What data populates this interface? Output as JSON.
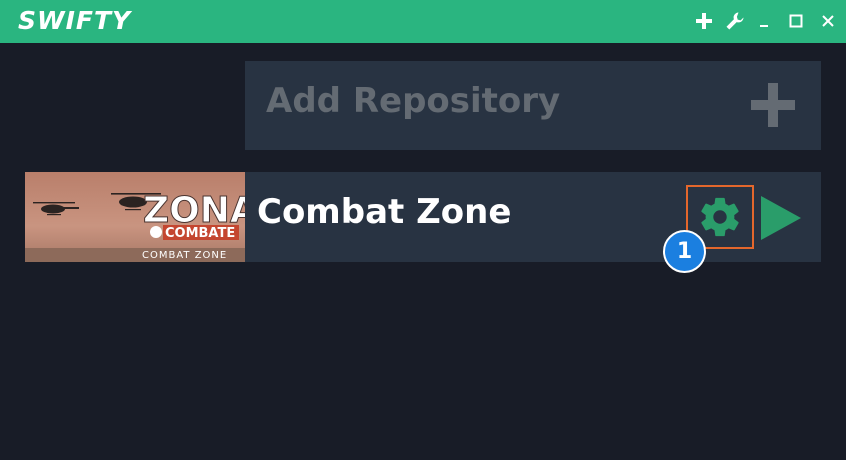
{
  "app": {
    "title": "SWIFTY"
  },
  "window_controls": {
    "add": "+",
    "settings_icon": "wrench-icon",
    "minimize": "_",
    "maximize": "☐",
    "close": "✕"
  },
  "add_repository": {
    "label": "Add Repository",
    "icon": "plus-icon"
  },
  "repositories": [
    {
      "name": "Combat Zone",
      "thumbnail": {
        "logo_text": "ZONA",
        "logo_subtext": "COMBATE",
        "caption": "COMBAT ZONE"
      },
      "settings_icon": "gear-icon",
      "play_icon": "play-icon"
    }
  ],
  "annotation": {
    "number": "1",
    "color": "#1b7fe0",
    "highlight_color": "#e4672c"
  },
  "colors": {
    "titlebar": "#2ab580",
    "background": "#181c27",
    "card": "#283342",
    "accent": "#2a9d6a"
  }
}
